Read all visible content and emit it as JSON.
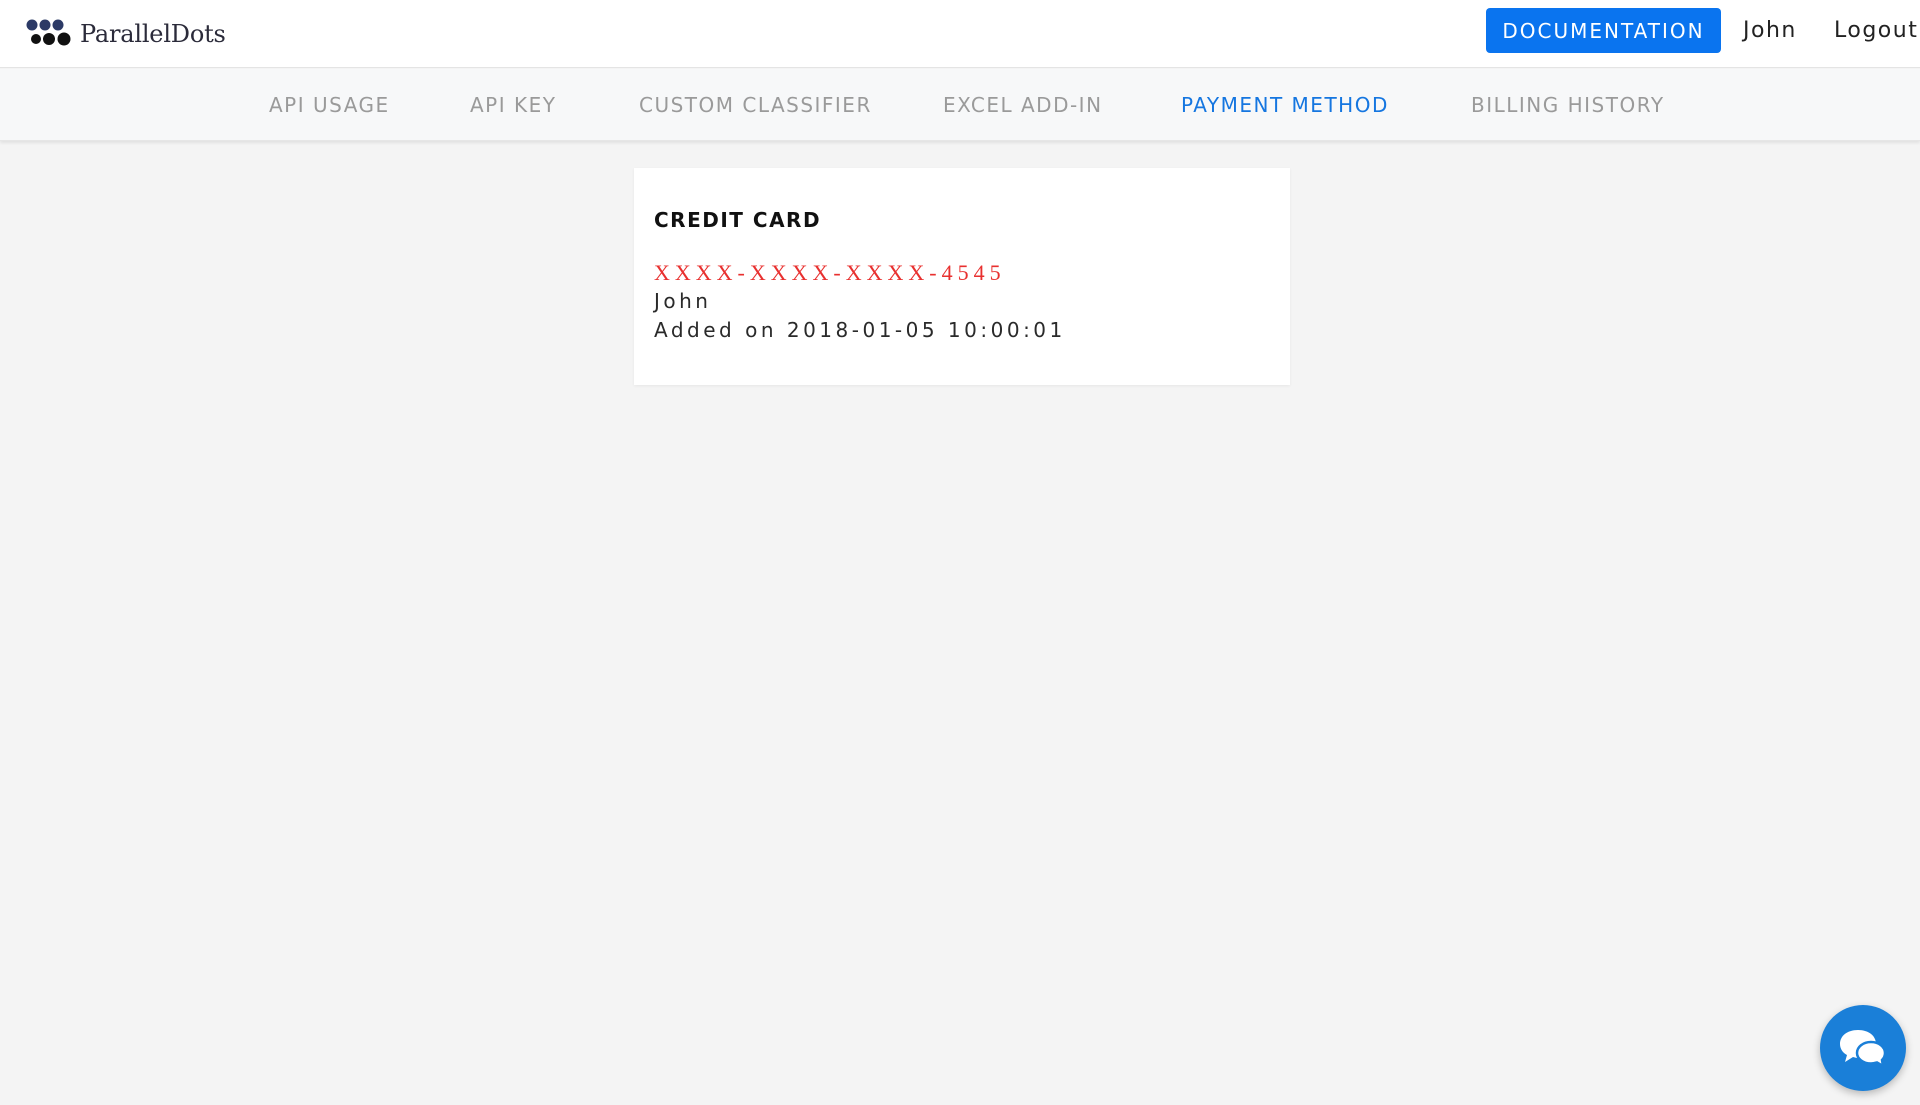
{
  "header": {
    "logo_text": "ParallelDots",
    "documentation_label": "DOCUMENTATION",
    "user_name": "John",
    "logout_label": "Logout",
    "accent_color": "#0a74ef"
  },
  "nav": {
    "items": [
      {
        "label": "API USAGE",
        "active": false
      },
      {
        "label": "API KEY",
        "active": false
      },
      {
        "label": "CUSTOM CLASSIFIER",
        "active": false
      },
      {
        "label": "EXCEL ADD-IN",
        "active": false
      },
      {
        "label": "PAYMENT METHOD",
        "active": true
      },
      {
        "label": "BILLING HISTORY",
        "active": false
      }
    ],
    "active_color": "#1576e0"
  },
  "card": {
    "title": "CREDIT CARD",
    "number": "XXXX-XXXX-XXXX-4545",
    "owner": "John",
    "added": "Added on 2018-01-05 10:00:01",
    "number_color": "#e8302f"
  },
  "chat": {
    "icon": "chat-bubbles-icon",
    "color": "#1a7fd8"
  }
}
